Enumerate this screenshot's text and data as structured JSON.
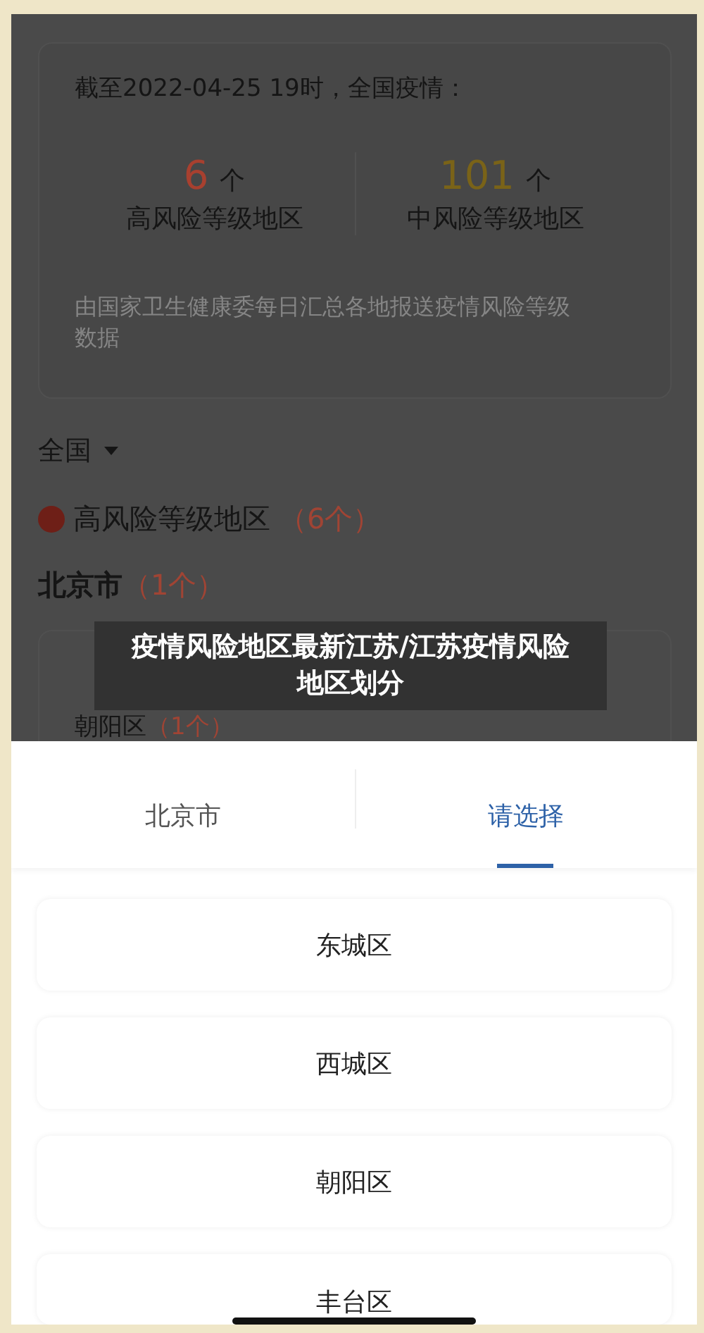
{
  "summary": {
    "heading": "截至2022-04-25 19时，全国疫情：",
    "stats": [
      {
        "value": "6",
        "unit": "个",
        "label": "高风险等级地区",
        "color": "#a8402f"
      },
      {
        "value": "101",
        "unit": "个",
        "label": "中风险等级地区",
        "color": "#7a6318"
      }
    ],
    "source": "由国家卫生健康委每日汇总各地报送疫情风险等级数据"
  },
  "region_filter": {
    "value": "全国"
  },
  "risk_group": {
    "label": "高风险等级地区",
    "count": "（6个）"
  },
  "city": {
    "name": "北京市",
    "count": "（1个）"
  },
  "district": {
    "name": "朝阳区",
    "count": "（1个）"
  },
  "caption": "疫情风险地区最新江苏/江苏疫情风险地区划分",
  "picker": {
    "tabs": [
      {
        "label": "北京市",
        "selected": false
      },
      {
        "label": "请选择",
        "selected": true
      }
    ],
    "options": [
      "东城区",
      "西城区",
      "朝阳区",
      "丰台区"
    ]
  }
}
